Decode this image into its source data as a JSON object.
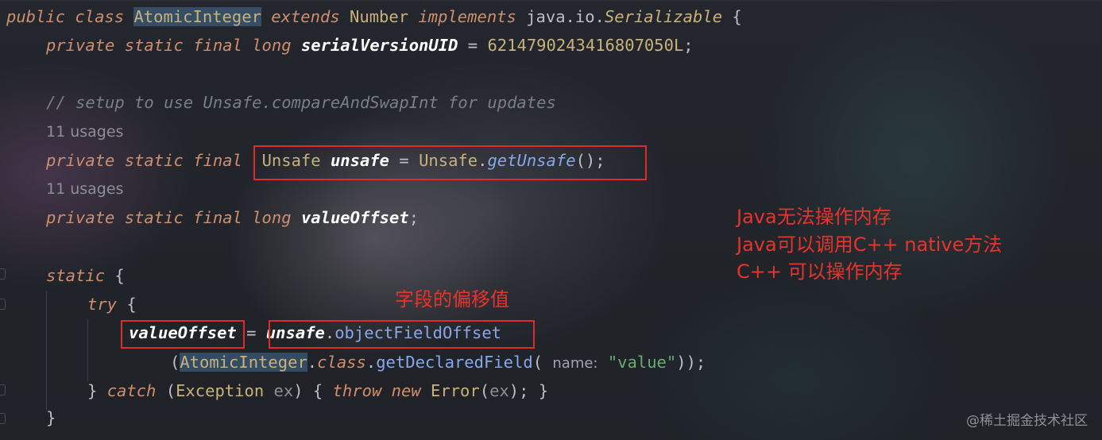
{
  "code": {
    "line1": {
      "public": "public",
      "class": "class",
      "classname": "AtomicInteger",
      "extends": "extends",
      "number": "Number",
      "implements": "implements",
      "pkg": "java.io.",
      "serializable": "Serializable",
      "brace": " {"
    },
    "line2": {
      "private": "private",
      "static": "static",
      "final": "final",
      "long": "long",
      "field": "serialVersionUID",
      "eq": " = ",
      "value": "6214790243416807050L",
      "semi": ";"
    },
    "comment": "// setup to use Unsafe.compareAndSwapInt for updates",
    "usages1": "11 usages",
    "line5": {
      "private": "private",
      "static": "static",
      "final": "final",
      "type": "Unsafe",
      "field": "unsafe",
      "eq": " = ",
      "cls": "Unsafe",
      "dot": ".",
      "method": "getUnsafe",
      "tail": "();"
    },
    "usages2": "11 usages",
    "line7": {
      "private": "private",
      "static": "static",
      "final": "final",
      "long": "long",
      "field": "valueOffset",
      "semi": ";"
    },
    "line8": {
      "static": "static",
      "brace": " {"
    },
    "line9": {
      "try": "try",
      "brace": " {"
    },
    "line10": {
      "field": "valueOffset",
      "eq": " = ",
      "obj": "unsafe",
      "dot": ".",
      "method": "objectFieldOffset"
    },
    "line11": {
      "open": "(",
      "cls": "AtomicInteger",
      "dot1": ".",
      "classkw": "class",
      "dot2": ".",
      "method": "getDeclaredField",
      "paren": "(",
      "hint": "name:",
      "str": "\"value\"",
      "tail": "));"
    },
    "line12": {
      "close": "} ",
      "catch": "catch",
      "open": " (",
      "exc": "Exception",
      "sp": " ",
      "ex": "ex",
      "close2": ") { ",
      "throw": "throw",
      "sp2": " ",
      "new": "new",
      "sp3": " ",
      "err": "Error",
      "po": "(",
      "ex2": "ex",
      "pc": "); }"
    },
    "line13": {
      "brace": "}"
    }
  },
  "annotations": {
    "java_memory": [
      "Java无法操作内存",
      "Java可以调用C++ native方法",
      "C++ 可以操作内存"
    ],
    "field_offset": "字段的偏移值"
  },
  "watermark": "@稀土掘金技术社区",
  "colors": {
    "keyword": "#cf8e6d",
    "type": "#c8b27a",
    "method": "#87a8e8",
    "string": "#6aab73",
    "comment": "#7a7e85",
    "annotation_red": "#e8332c"
  }
}
